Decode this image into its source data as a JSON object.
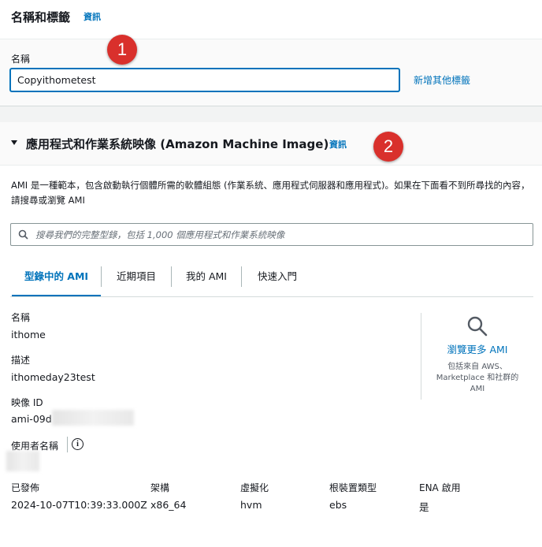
{
  "name_section": {
    "title": "名稱和標籤",
    "info": "資訊",
    "field_label": "名稱",
    "field_value": "Copyithometest",
    "add_tags": "新增其他標籤"
  },
  "ami_section": {
    "title": "應用程式和作業系統映像 (Amazon Machine Image)",
    "info": "資訊",
    "description": "AMI 是一種範本，包含啟動執行個體所需的軟體組態 (作業系統、應用程式伺服器和應用程式)。如果在下面看不到所尋找的內容，請搜尋或瀏覽 AMI",
    "search_placeholder": "搜尋我們的完整型錄，包括 1,000 個應用程式和作業系統映像",
    "tabs": [
      "型錄中的 AMI",
      "近期項目",
      "我的 AMI",
      "快速入門"
    ]
  },
  "ami_details": {
    "name_label": "名稱",
    "name_value": "ithome",
    "desc_label": "描述",
    "desc_value": "ithomeday23test",
    "image_id_label": "映像 ID",
    "image_id_value": "ami-09d",
    "username_label": "使用者名稱",
    "columns": {
      "published": {
        "label": "已發佈",
        "value": "2024-10-07T10:39:33.000Z"
      },
      "arch": {
        "label": "架構",
        "value": "x86_64"
      },
      "virt": {
        "label": "虛擬化",
        "value": "hvm"
      },
      "root": {
        "label": "根裝置類型",
        "value": "ebs"
      },
      "ena": {
        "label": "ENA 啟用",
        "value": "是"
      }
    }
  },
  "browse": {
    "label": "瀏覽更多 AMI",
    "sub": "包括來自 AWS、Marketplace 和社群的 AMI",
    "icon": "search-icon"
  },
  "annotations": {
    "badge1": "1",
    "badge2": "2",
    "color": "#d9302c"
  }
}
